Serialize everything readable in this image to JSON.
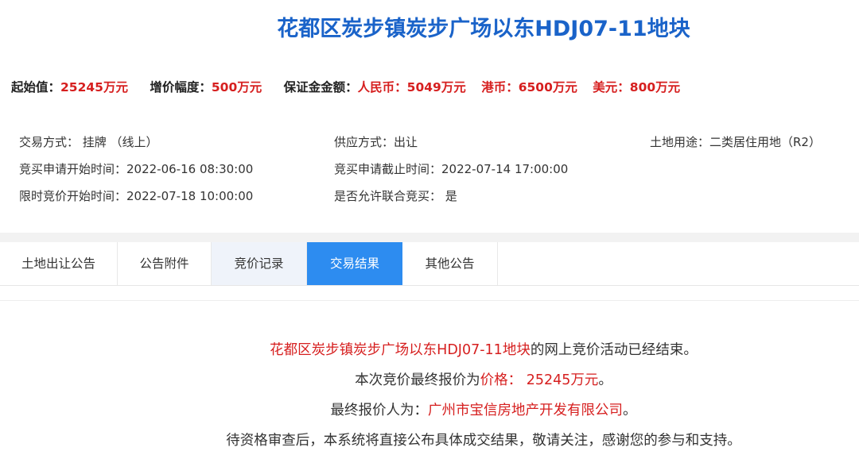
{
  "title": "花都区炭步镇炭步广场以东HDJ07-11地块",
  "price_bar": {
    "start_label": "起始值：",
    "start_value": "25245万元",
    "increment_label": "增价幅度：",
    "increment_value": "500万元",
    "deposit_label": "保证金金额：",
    "rmb_label": "人民币：",
    "rmb_value": "5049万元",
    "hkd_label": "港币：",
    "hkd_value": "6500万元",
    "usd_label": "美元：",
    "usd_value": "800万元"
  },
  "info": {
    "trade_method": "交易方式：  挂牌  （线上）",
    "supply_method": "供应方式：出让",
    "land_use": "土地用途：二类居住用地（R2）",
    "apply_start": "竞买申请开始时间：2022-06-16 08:30:00",
    "apply_end": "竞买申请截止时间：2022-07-14 17:00:00",
    "bid_start": "限时竞价开始时间：2022-07-18 10:00:00",
    "joint_bid": "是否允许联合竞买：  是"
  },
  "tabs": [
    {
      "label": "土地出让公告"
    },
    {
      "label": "公告附件"
    },
    {
      "label": "竞价记录"
    },
    {
      "label": "交易结果"
    },
    {
      "label": "其他公告"
    }
  ],
  "result": {
    "line1_parcel": "花都区炭步镇炭步广场以东HDJ07-11地块",
    "line1_rest": "的网上竞价活动已经结束。",
    "line2_prefix": "本次竞价最终报价为",
    "line2_price": "价格：  25245万元",
    "line2_suffix": "。",
    "line3_prefix": "最终报价人为：",
    "line3_company": "广州市宝信房地产开发有限公司",
    "line3_suffix": "。",
    "line4": "待资格审查后，本系统将直接公布具体成交结果，敬请关注，感谢您的参与和支持。"
  },
  "colors": {
    "title_blue": "#1a63c9",
    "accent_red": "#d61f1f",
    "active_tab": "#2d8cf0"
  }
}
